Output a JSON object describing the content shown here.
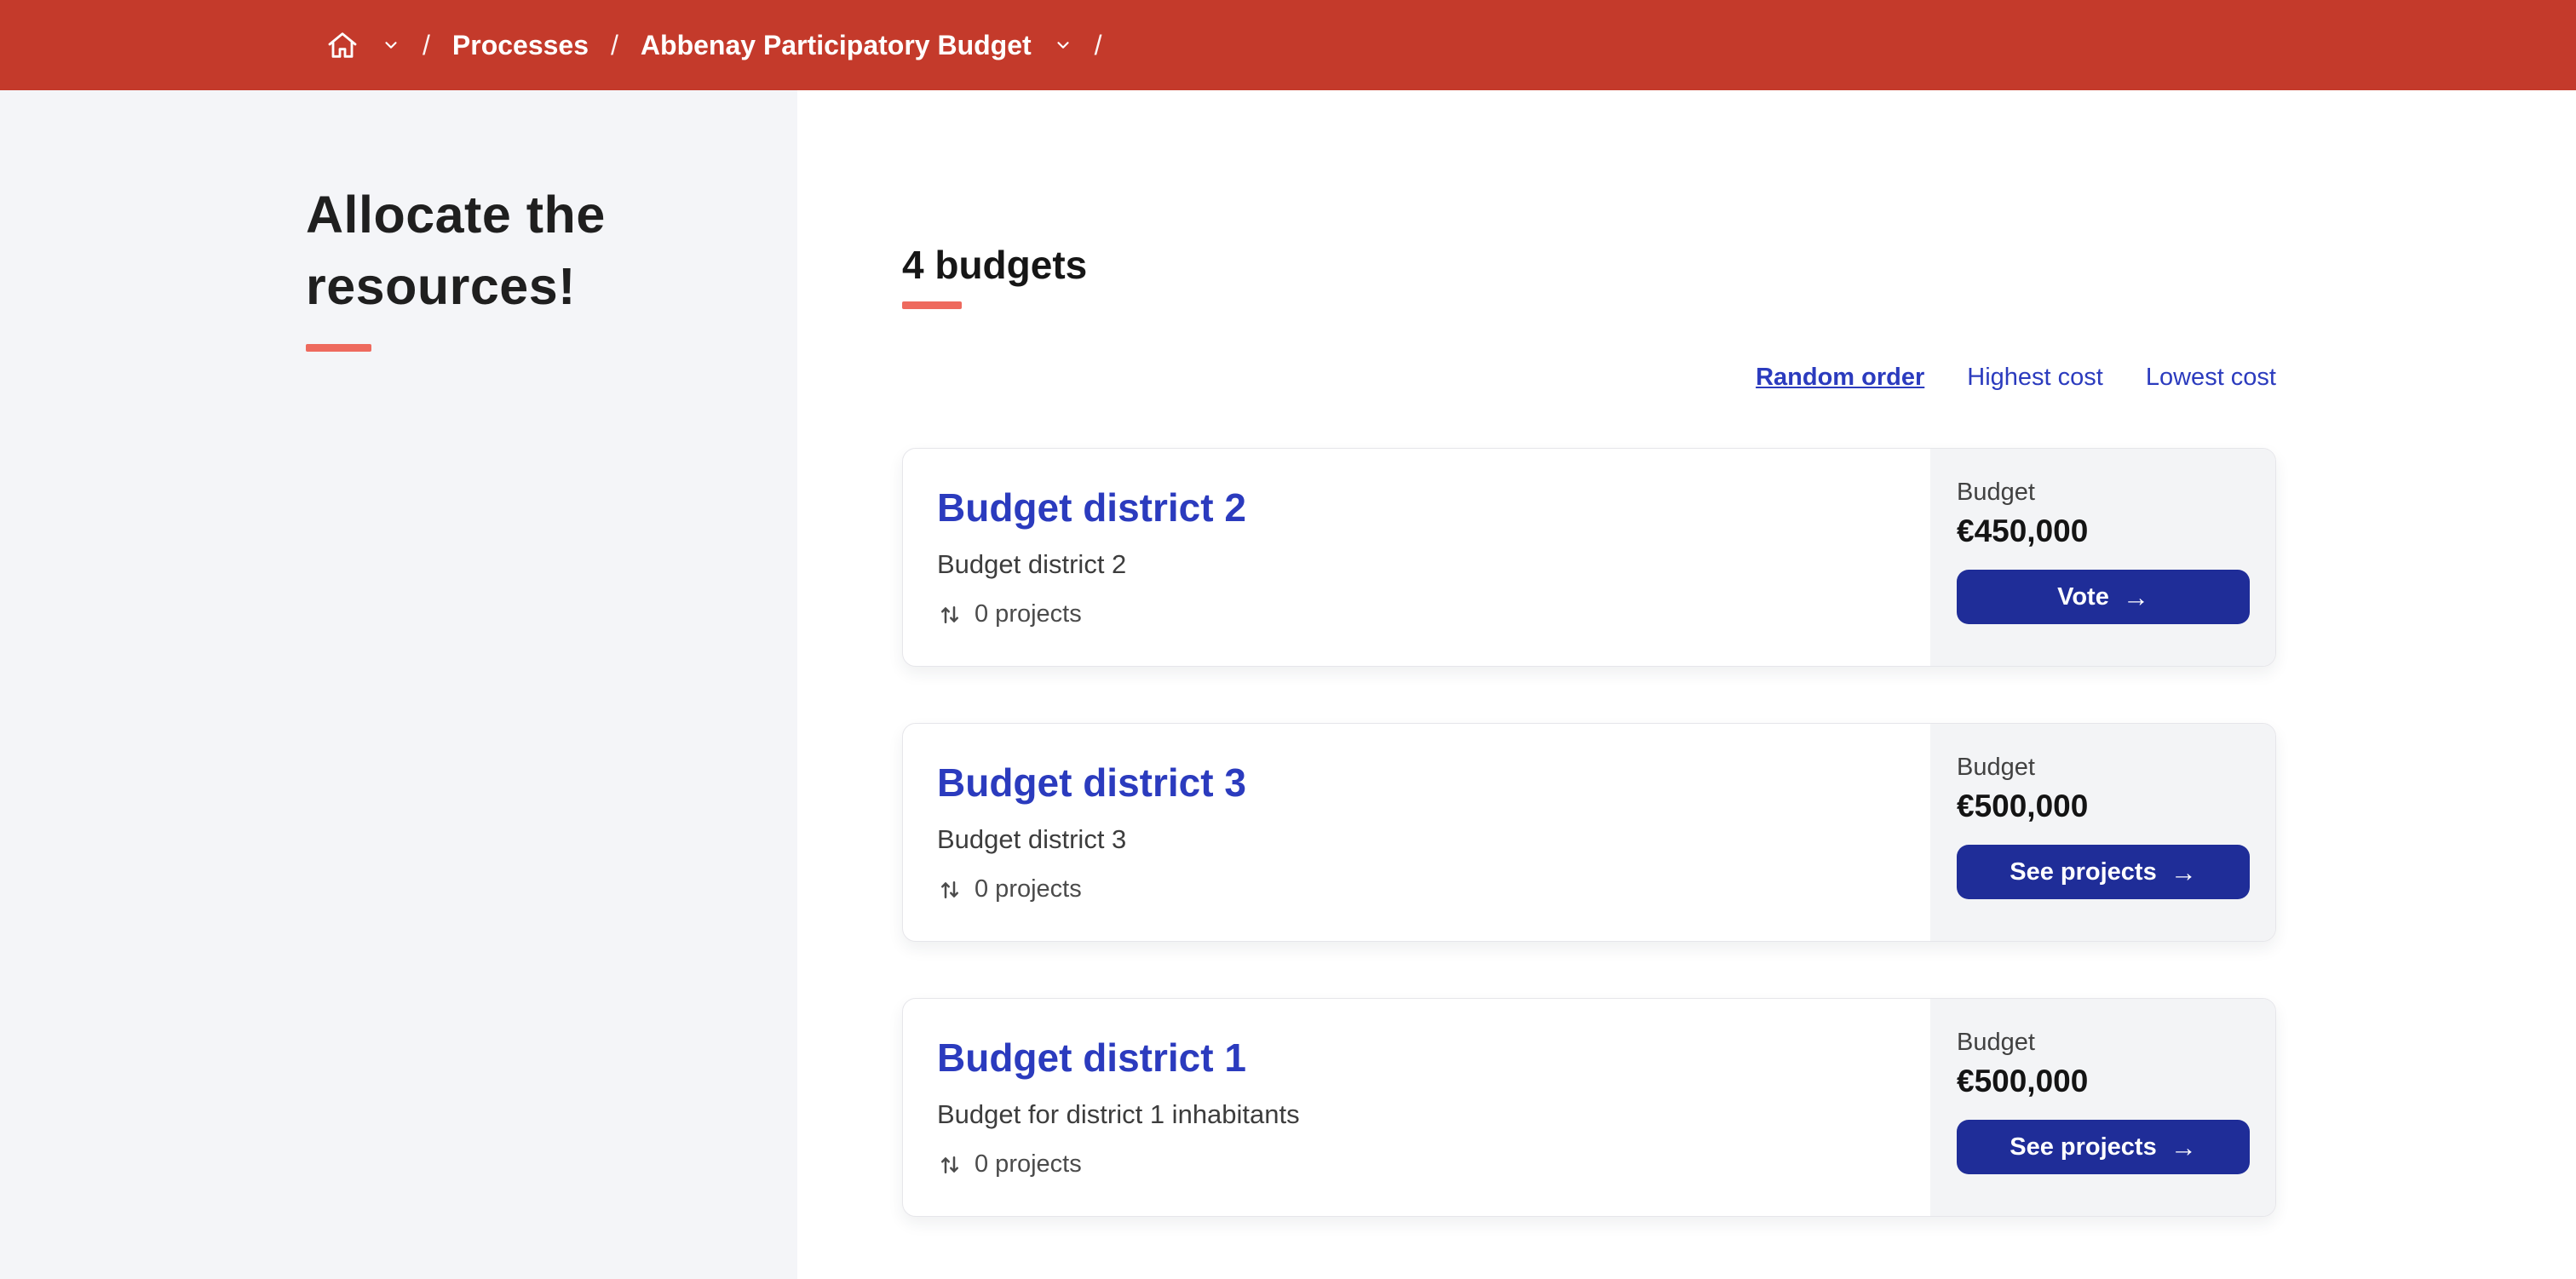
{
  "breadcrumb": {
    "separator": "/",
    "items": [
      {
        "label": "Processes"
      },
      {
        "label": "Abbenay Participatory Budget"
      }
    ]
  },
  "sidebar": {
    "title": "Allocate the resources!"
  },
  "main": {
    "heading": "4 budgets",
    "sort": [
      {
        "label": "Random order",
        "active": true
      },
      {
        "label": "Highest cost",
        "active": false
      },
      {
        "label": "Lowest cost",
        "active": false
      }
    ],
    "budgets": [
      {
        "title": "Budget district 2",
        "description": "Budget district 2",
        "projects": "0 projects",
        "budget_label": "Budget",
        "amount": "€450,000",
        "button": "Vote"
      },
      {
        "title": "Budget district 3",
        "description": "Budget district 3",
        "projects": "0 projects",
        "budget_label": "Budget",
        "amount": "€500,000",
        "button": "See projects"
      },
      {
        "title": "Budget district 1",
        "description": "Budget for district 1 inhabitants",
        "projects": "0 projects",
        "budget_label": "Budget",
        "amount": "€500,000",
        "button": "See projects"
      }
    ]
  },
  "colors": {
    "topbar_red": "#c43a2b",
    "accent_salmon": "#ee6a5e",
    "link_blue": "#2b3bbe",
    "button_navy": "#1f2d98",
    "sidebar_bg": "#f4f5f8",
    "panel_bg": "#f3f4f6"
  }
}
